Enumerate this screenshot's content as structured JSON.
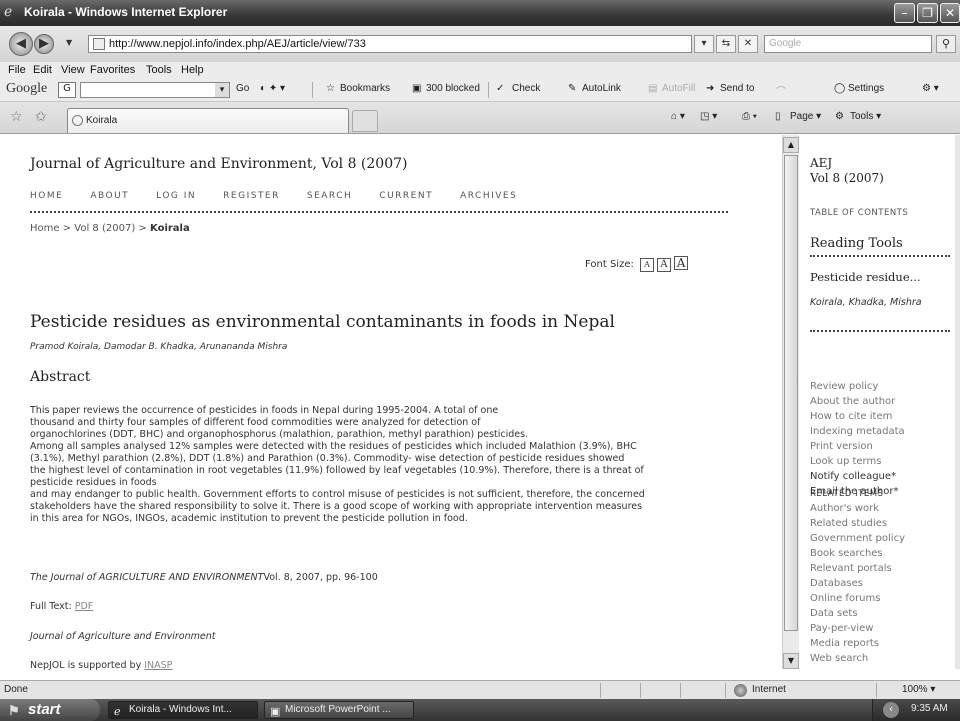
{
  "window": {
    "title": "Koirala - Windows Internet Explorer",
    "buttons": {
      "minimize": "–",
      "maximize": "❐",
      "close": "✕"
    }
  },
  "address_bar": {
    "url": "http://www.nepjol.info/index.php/AEJ/article/view/733",
    "search_placeholder": "Google"
  },
  "menu": [
    "File",
    "Edit",
    "View",
    "Favorites",
    "Tools",
    "Help"
  ],
  "google_toolbar": {
    "logo": "Google",
    "field_letter": "G",
    "go": "Go",
    "bookmarks": "Bookmarks",
    "blocked": "300 blocked",
    "check": "Check",
    "autolink": "AutoLink",
    "autofill": "AutoFill",
    "send_to": "Send to",
    "settings": "Settings"
  },
  "tabs": {
    "active_tab": "Koirala",
    "page_menu": "Page",
    "tools_menu": "Tools"
  },
  "page": {
    "journal_title": "Journal of Agriculture and Environment, Vol 8 (2007)",
    "nav": [
      "HOME",
      "ABOUT",
      "LOG IN",
      "REGISTER",
      "SEARCH",
      "CURRENT",
      "ARCHIVES"
    ],
    "breadcrumb": {
      "home": "Home",
      "sep1": ">",
      "volume": "Vol 8 (2007)",
      "sep2": ">",
      "current": "Koirala"
    },
    "font_size_label": "Font Size:",
    "font_size_options": [
      "A",
      "A",
      "A"
    ],
    "article_title": "Pesticide residues as environmental contaminants in foods in Nepal",
    "authors": "Pramod Koirala, Damodar B. Khadka, Arunananda Mishra",
    "abstract_heading": "Abstract",
    "abstract_lines": [
      "This paper reviews the occurrence of pesticides in foods in Nepal during 1995-2004. A total of one",
      "thousand and thirty four samples of different food commodities were analyzed for detection of",
      "organochlorines (DDT, BHC) and organophosphorus (malathion, parathion, methyl parathion) pesticides.",
      "Among all samples analysed 12% samples were detected with the residues of pesticides which included Malathion (3.9%), BHC",
      "(3.1%), Methyl parathion (2.8%), DDT (1.8%) and Parathion (0.3%). Commodity- wise detection of pesticide residues showed",
      "the highest level of contamination in root vegetables (11.9%) followed by leaf vegetables (10.9%). Therefore, there is a threat of",
      "pesticide residues in foods",
      "and may endanger to public health. Government efforts to control misuse of pesticides is not sufficient, therefore, the concerned",
      "stakeholders have the shared responsibility to solve it. There is a good scope of working with appropriate intervention measures",
      "in this area for NGOs, INGOs, academic institution to prevent the pesticide pollution in food."
    ],
    "citation_journal": "The Journal of AGRICULTURE AND ENVIRONMENT",
    "citation_details": "Vol. 8, 2007, pp. 96-100",
    "full_text_label": "Full Text:",
    "full_text_link": "PDF",
    "journal_name": "Journal of Agriculture and Environment",
    "supported_by_label": "NepJOL is supported by",
    "supported_by_link": "INASP"
  },
  "sidebar": {
    "journal_abbr": "AEJ",
    "volume": "Vol 8 (2007)",
    "toc": "TABLE OF CONTENTS",
    "reading_tools": "Reading Tools",
    "article_short": "Pesticide residue...",
    "authors_short": "Koirala, Khadka, Mishra",
    "tools": [
      "Review policy",
      "About the author",
      "How to cite item",
      "Indexing metadata",
      "Print version",
      "Look up terms"
    ],
    "tools_dark": [
      "Notify colleague*",
      "Email the author*"
    ],
    "related_heading": "RELATED ITEMS",
    "related": [
      "Author's work",
      "Related studies",
      "Government policy",
      "Book searches",
      "Relevant portals",
      "Databases",
      "Online forums",
      "Data sets",
      "Pay-per-view",
      "Media reports",
      "Web search"
    ]
  },
  "status_bar": {
    "status": "Done",
    "zone": "Internet",
    "zoom": "100%"
  },
  "taskbar": {
    "start": "start",
    "items": [
      "Koirala - Windows Int...",
      "Microsoft PowerPoint ..."
    ],
    "clock": "9:35 AM"
  }
}
